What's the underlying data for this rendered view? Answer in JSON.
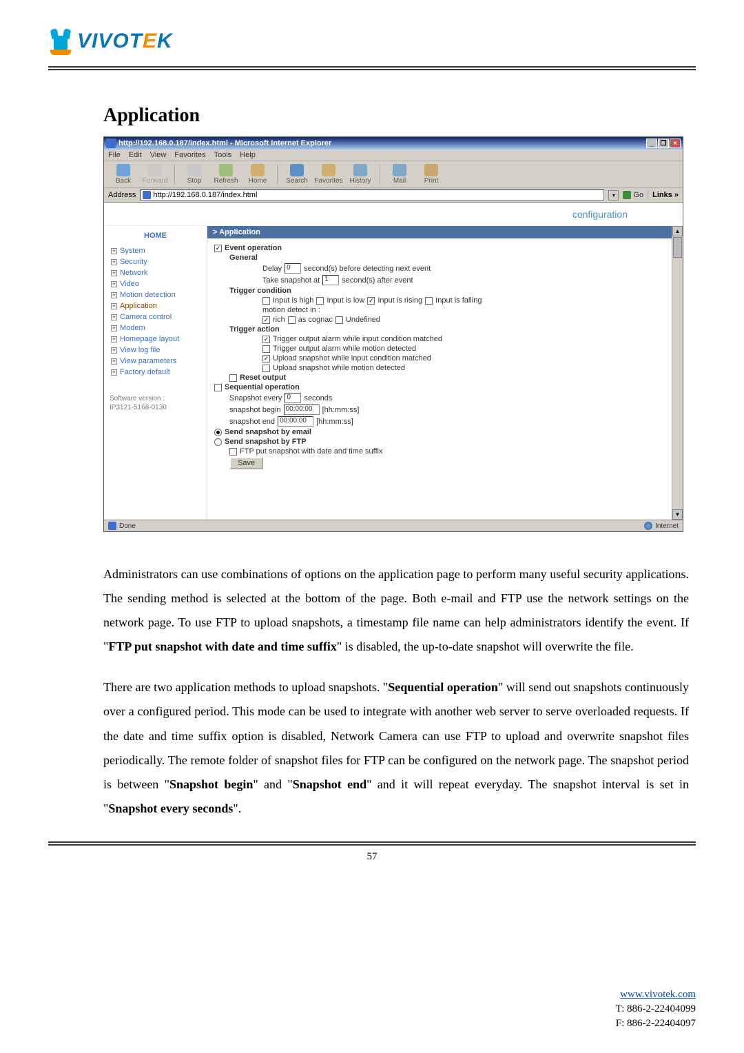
{
  "logo": {
    "text_main": "VIVOT",
    "text_accent": "E",
    "text_end": "K"
  },
  "section_title": "Application",
  "browser": {
    "title": "http://192.168.0.187/index.html - Microsoft Internet Explorer",
    "menus": [
      "File",
      "Edit",
      "View",
      "Favorites",
      "Tools",
      "Help"
    ],
    "toolbar": [
      {
        "label": "Back",
        "color": "#6fa3d8"
      },
      {
        "label": "Forward",
        "color": "#bfbfbf"
      },
      {
        "label": "Stop",
        "color": "#c8c8c8"
      },
      {
        "label": "Refresh",
        "color": "#9fbf7f"
      },
      {
        "label": "Home",
        "color": "#cfae70"
      },
      {
        "label": "Search",
        "color": "#5f8fc8"
      },
      {
        "label": "Favorites",
        "color": "#cfae70"
      },
      {
        "label": "History",
        "color": "#7fa8c8"
      },
      {
        "label": "Mail",
        "color": "#7fa8c8"
      },
      {
        "label": "Print",
        "color": "#c8a870"
      }
    ],
    "address_label": "Address",
    "address_value": "http://192.168.0.187/index.html",
    "go_label": "Go",
    "links_label": "Links »",
    "status_left": "Done",
    "status_right": "Internet"
  },
  "page": {
    "banner": "configuration",
    "sidebar": {
      "home": "HOME",
      "items": [
        "System",
        "Security",
        "Network",
        "Video",
        "Motion detection",
        "Application",
        "Camera control",
        "Modem",
        "Homepage layout",
        "View log file",
        "View parameters",
        "Factory default"
      ],
      "version_label": "Software version :",
      "version_value": "IP3121-5168-0130"
    },
    "panel": {
      "header": "> Application",
      "event_operation": "Event operation",
      "general": "General",
      "delay_prefix": "Delay",
      "delay_value": "0",
      "delay_suffix": "second(s) before detecting next event",
      "snapshot_at_prefix": "Take snapshot at",
      "snapshot_at_value": "1",
      "snapshot_at_suffix": "second(s) after event",
      "trigger_condition": "Trigger condition",
      "tc_high": "Input is high",
      "tc_low": "Input is low",
      "tc_rising": "Input is rising",
      "tc_falling": "Input is falling",
      "motion_detect_in": "motion detect in :",
      "md_rich": "rich",
      "md_cognac": "as cognac",
      "md_undefined": "Undefined",
      "trigger_action": "Trigger action",
      "ta_out_input": "Trigger output alarm while input condition matched",
      "ta_out_motion": "Trigger output alarm while motion detected",
      "ta_up_input": "Upload snapshot while input condition matched",
      "ta_up_motion": "Upload snapshot while motion detected",
      "reset_output": "Reset output",
      "seq_operation": "Sequential operation",
      "snap_every_prefix": "Snapshot every",
      "snap_every_value": "0",
      "snap_every_suffix": "seconds",
      "snap_begin_prefix": "snapshot begin",
      "snap_begin_value": "00:00:00",
      "snap_begin_suffix": "[hh:mm:ss]",
      "snap_end_prefix": "snapshot end",
      "snap_end_value": "00:00:00",
      "snap_end_suffix": "[hh:mm:ss]",
      "send_email": "Send snapshot by email",
      "send_ftp": "Send snapshot by FTP",
      "ftp_suffix": "FTP put snapshot with date and time suffix",
      "save": "Save"
    }
  },
  "paragraphs": {
    "p1_a": "Administrators can use combinations of options on the application page to perform many useful security applications. The sending method is selected at the bottom of the page. Both e-mail and FTP use the network settings on the network page. To use FTP to upload snapshots, a timestamp file name can help administrators identify the event. If \"",
    "p1_b": "FTP put snapshot with date and time suffix",
    "p1_c": "\" is disabled, the up-to-date snapshot will overwrite the file.",
    "p2_a": "There are two application methods to upload snapshots. \"",
    "p2_b": "Sequential operation",
    "p2_c": "\" will send out snapshots continuously over a configured period. This mode can be used to integrate with another web server to serve overloaded requests. If the date and time suffix option is disabled, Network Camera can use FTP to upload and overwrite snapshot files periodically. The remote folder of snapshot files for FTP can be configured on the network page. The snapshot period is between \"",
    "p2_d": "Snapshot begin",
    "p2_e": "\" and \"",
    "p2_f": "Snapshot end",
    "p2_g": "\" and it will repeat everyday. The snapshot interval is set in \"",
    "p2_h": "Snapshot every seconds",
    "p2_i": "\"."
  },
  "page_number": "57",
  "footer": {
    "url": "www.vivotek.com",
    "tel": "T: 886-2-22404099",
    "fax": "F: 886-2-22404097"
  }
}
